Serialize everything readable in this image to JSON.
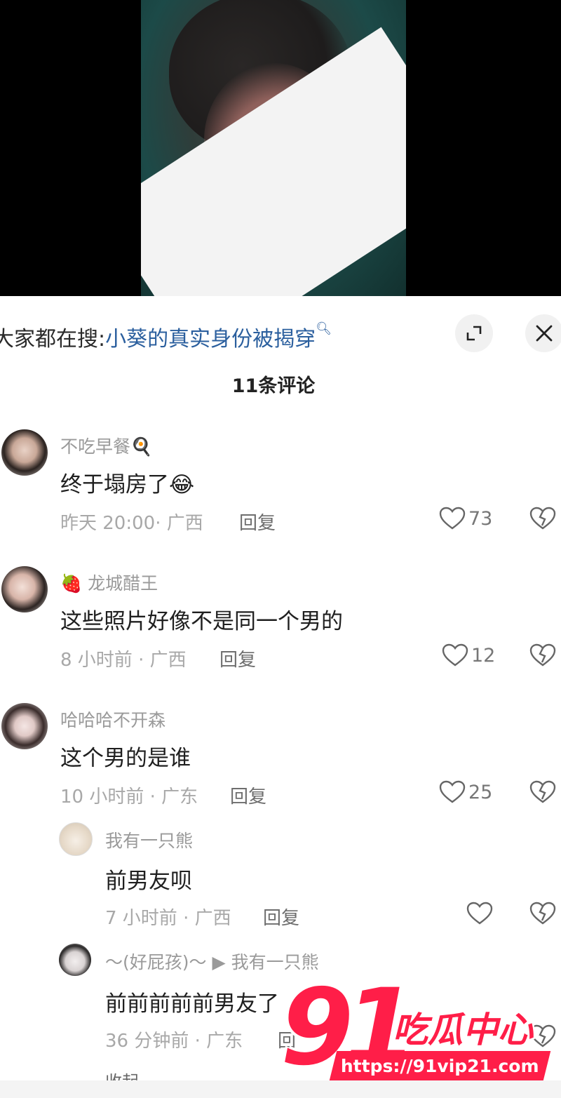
{
  "search": {
    "prefix": "大家都在搜:",
    "keyword": "小葵的真实身份被揭穿"
  },
  "comments_header": "11条评论",
  "comments": [
    {
      "user": "不吃早餐🍳",
      "text": "终于塌房了😂",
      "time": "昨天 20:00· 广西",
      "reply": "回复",
      "likes": "73"
    },
    {
      "user": "🍓 龙城醋王",
      "text": "这些照片好像不是同一个男的",
      "time": "8 小时前 · 广西",
      "reply": "回复",
      "likes": "12"
    },
    {
      "user": "哈哈哈不开森",
      "text": "这个男的是谁",
      "time": "10 小时前 · 广东",
      "reply": "回复",
      "likes": "25"
    }
  ],
  "replies": [
    {
      "user": "我有一只熊",
      "text": "前男友呗",
      "time": "7 小时前 · 广西",
      "reply": "回复"
    },
    {
      "user": "～(好屁孩)～ ▶ 我有一只熊",
      "text": "前前前前前男友了",
      "time": "36 分钟前 · 广东",
      "reply": "回"
    }
  ],
  "collapse_label": "收起",
  "watermark": {
    "number": "91",
    "brand": "吃瓜中心",
    "url": "https://91vip21.com"
  },
  "colors": {
    "accent_link": "#2b5f9e",
    "watermark_red": "#ff1e48"
  }
}
